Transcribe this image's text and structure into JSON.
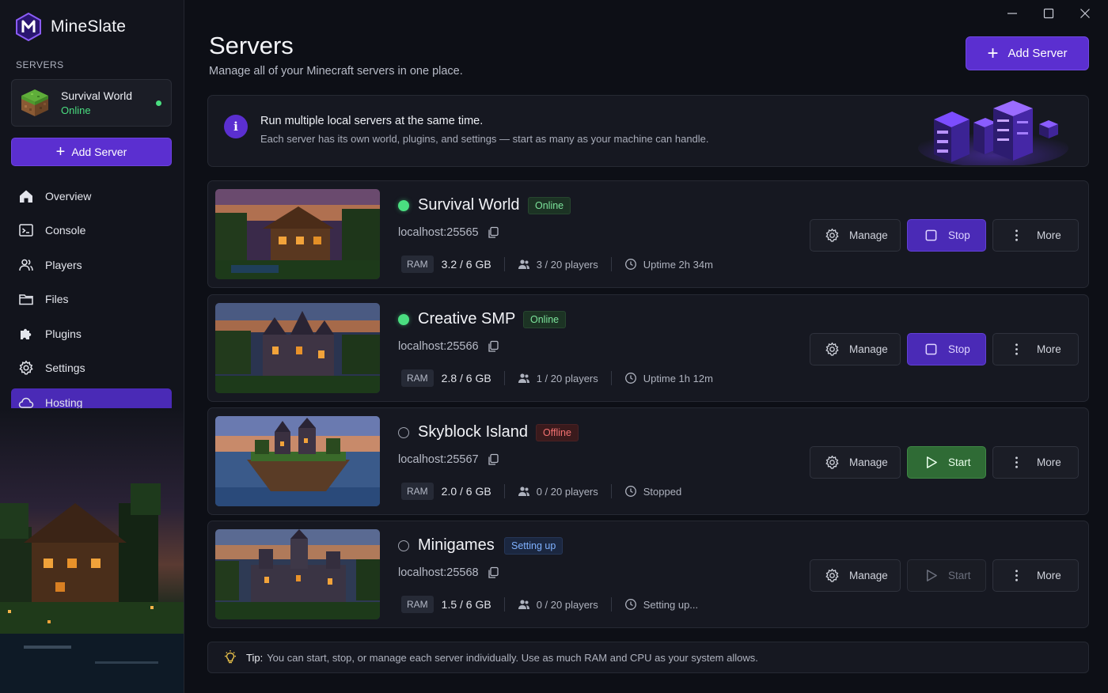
{
  "app": {
    "name": "MineSlate"
  },
  "sidebar": {
    "section_label": "SERVERS",
    "current_server": {
      "name": "Survival World",
      "status": "Online"
    },
    "add_button": "Add Server",
    "nav": [
      {
        "label": "Overview",
        "icon": "home-icon"
      },
      {
        "label": "Console",
        "icon": "console-icon"
      },
      {
        "label": "Players",
        "icon": "players-icon"
      },
      {
        "label": "Files",
        "icon": "folder-icon"
      },
      {
        "label": "Plugins",
        "icon": "puzzle-icon"
      },
      {
        "label": "Settings",
        "icon": "gear-icon"
      },
      {
        "label": "Hosting",
        "icon": "cloud-icon",
        "active": true
      }
    ]
  },
  "header": {
    "title": "Servers",
    "subtitle": "Manage all of your Minecraft servers in one place.",
    "add_button": "Add Server"
  },
  "banner": {
    "title": "Run multiple local servers at the same time.",
    "subtitle": "Each server has its own world, plugins, and settings — start as many as your machine can handle."
  },
  "servers": [
    {
      "name": "Survival World",
      "status": "Online",
      "address": "localhost:25565",
      "ram_label": "RAM",
      "ram": "3.2 / 6 GB",
      "players": "3  /  20 players",
      "uptime": "Uptime 2h 34m",
      "manage": "Manage",
      "primary": "Stop",
      "more": "More"
    },
    {
      "name": "Creative SMP",
      "status": "Online",
      "address": "localhost:25566",
      "ram_label": "RAM",
      "ram": "2.8 / 6 GB",
      "players": "1  /  20 players",
      "uptime": "Uptime 1h 12m",
      "manage": "Manage",
      "primary": "Stop",
      "more": "More"
    },
    {
      "name": "Skyblock Island",
      "status": "Offline",
      "address": "localhost:25567",
      "ram_label": "RAM",
      "ram": "2.0 / 6 GB",
      "players": "0  /  20 players",
      "uptime": "Stopped",
      "manage": "Manage",
      "primary": "Start",
      "more": "More"
    },
    {
      "name": "Minigames",
      "status": "Setting up",
      "address": "localhost:25568",
      "ram_label": "RAM",
      "ram": "1.5 / 6 GB",
      "players": "0  /  20 players",
      "uptime": "Setting up...",
      "manage": "Manage",
      "primary": "Start",
      "more": "More"
    }
  ],
  "tip": {
    "label": "Tip:",
    "text": "You can start, stop, or manage each server individually. Use as much RAM and CPU as your system allows."
  },
  "colors": {
    "accent": "#5b2fd0",
    "online": "#4ade80",
    "offline": "#f27171",
    "setup": "#7fb1ff",
    "start": "#2f6b35"
  }
}
